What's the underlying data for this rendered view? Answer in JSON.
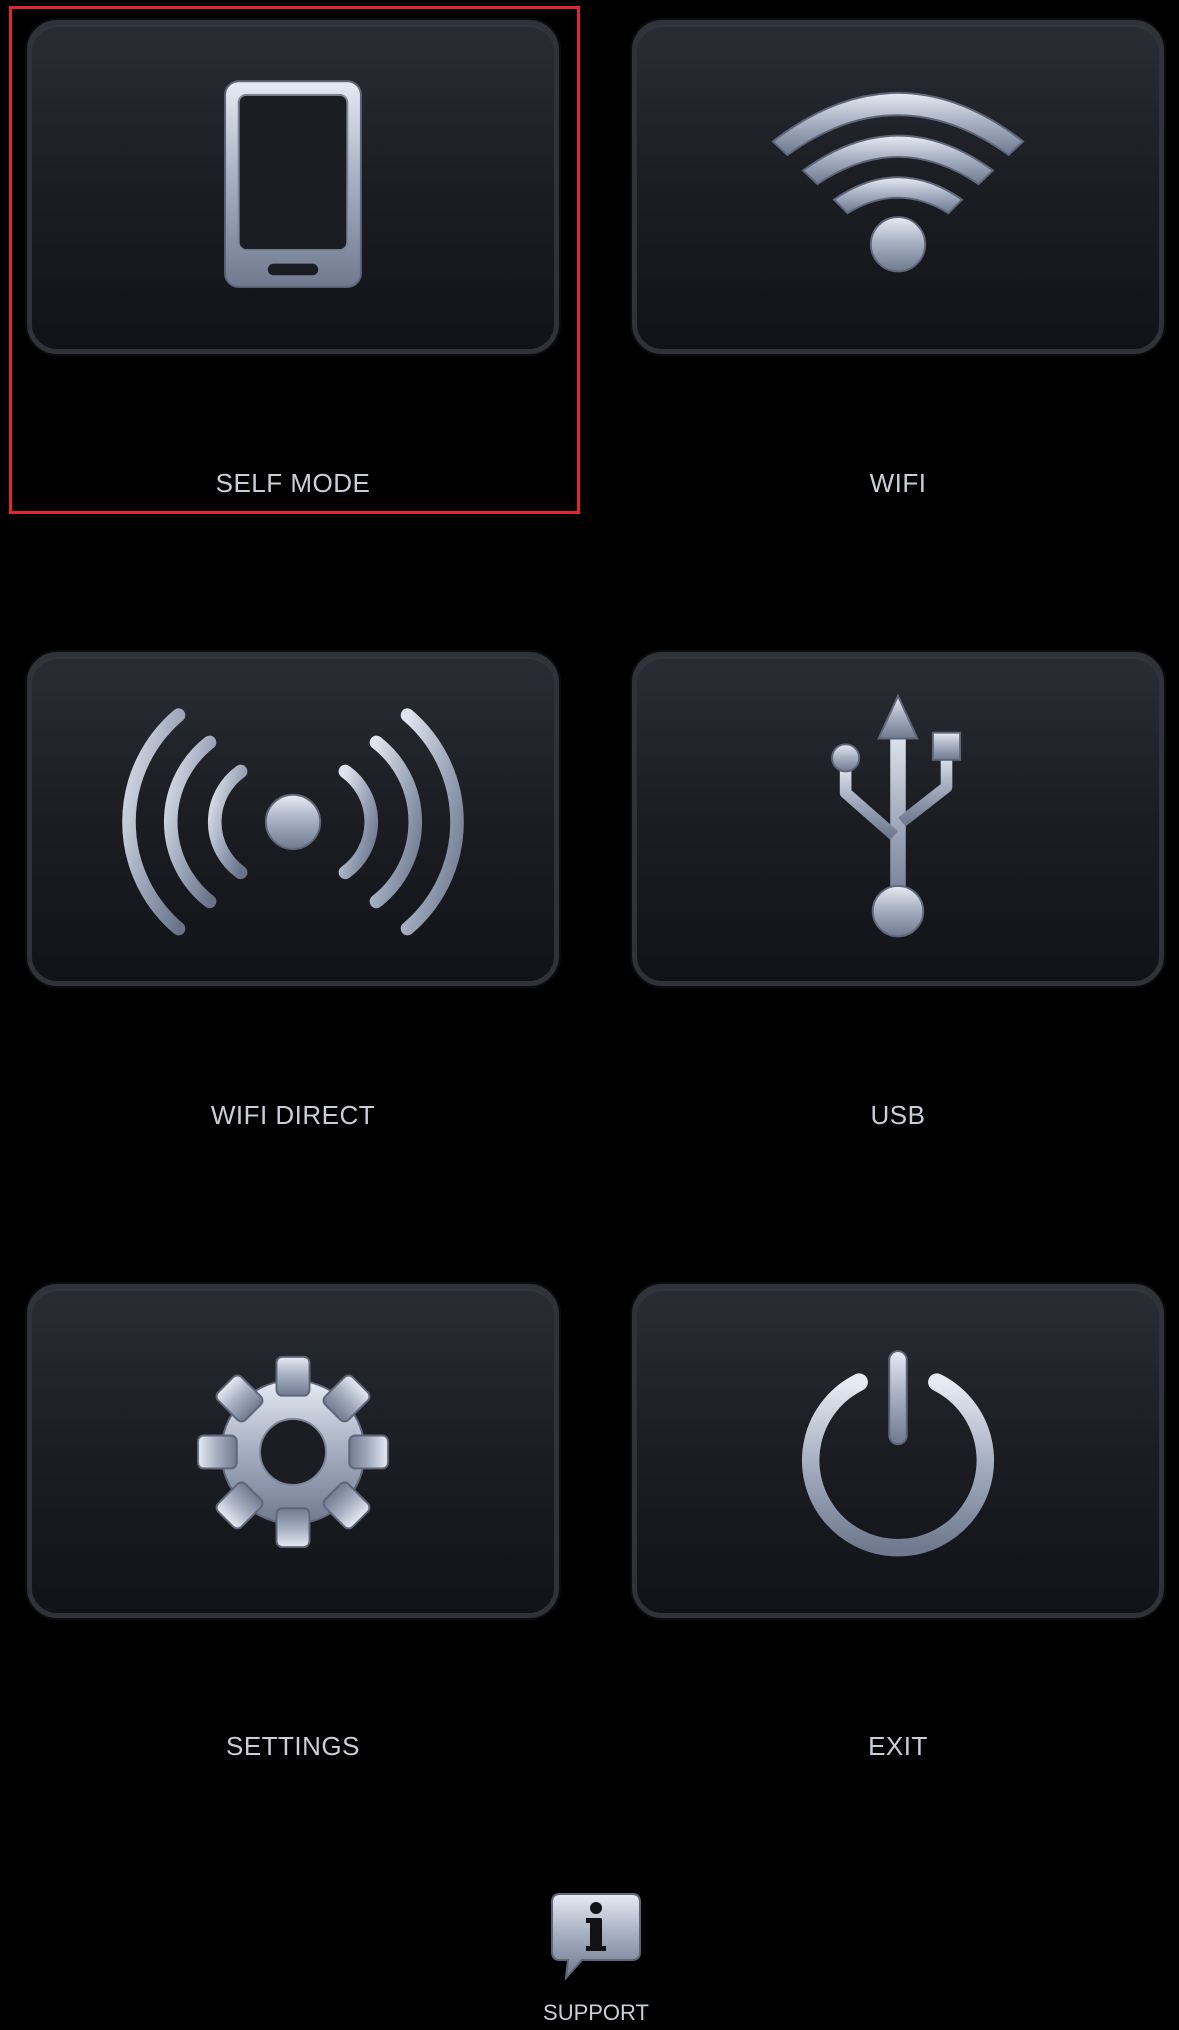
{
  "menu": {
    "self_mode": {
      "label": "SELF MODE",
      "icon": "smartphone-icon"
    },
    "wifi": {
      "label": "WIFI",
      "icon": "wifi-icon"
    },
    "wifi_direct": {
      "label": "WIFI DIRECT",
      "icon": "broadcast-icon"
    },
    "usb": {
      "label": "USB",
      "icon": "usb-icon"
    },
    "settings": {
      "label": "SETTINGS",
      "icon": "gear-icon"
    },
    "exit": {
      "label": "EXIT",
      "icon": "power-icon"
    }
  },
  "support": {
    "label": "SUPPORT",
    "icon": "info-bubble-icon"
  },
  "colors": {
    "background": "#000000",
    "tile": "#1c1e24",
    "icon_metal": "#a9b2c3",
    "label": "#c9cfd8",
    "selection": "#e0262e"
  }
}
